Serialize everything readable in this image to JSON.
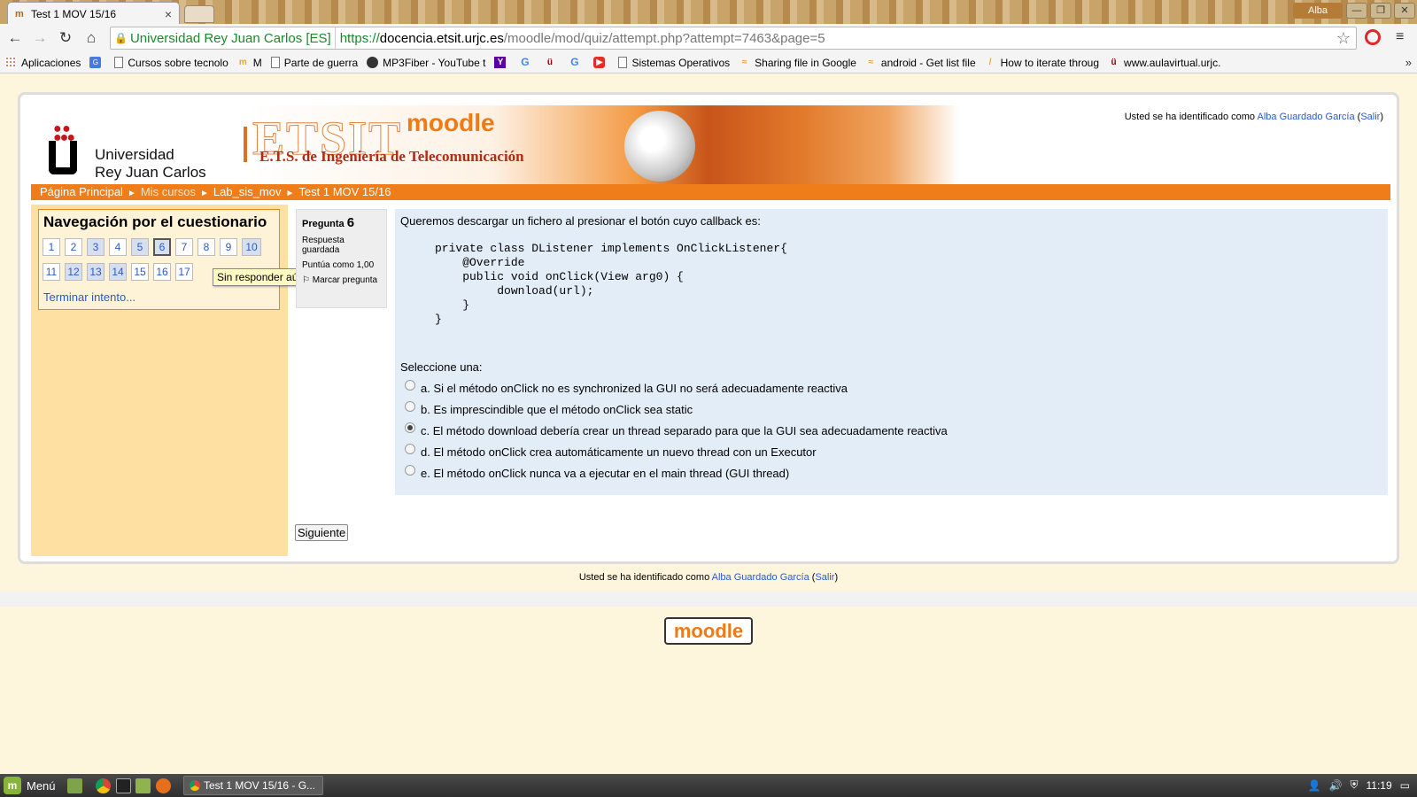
{
  "browser": {
    "tab_title": "Test 1 MOV 15/16",
    "tab_close": "×",
    "profile_name": "Alba",
    "window_buttons": [
      "—",
      "❐",
      "✕"
    ],
    "nav_icons": [
      "←",
      "→",
      "↻",
      "⌂"
    ],
    "ev_badge": "Universidad Rey Juan Carlos [ES]",
    "url_scheme": "https://",
    "url_host": "docencia.etsit.urjc.es",
    "url_path": "/moodle/mod/quiz/attempt.php?attempt=7463&page=5",
    "bookmarks": [
      {
        "icon": "apps-icon",
        "label": "Aplicaciones"
      },
      {
        "icon": "translate-icon",
        "label": ""
      },
      {
        "icon": "page-icon",
        "label": "Cursos sobre tecnolo"
      },
      {
        "icon": "moodle-icon",
        "label": "M"
      },
      {
        "icon": "page-icon",
        "label": "Parte de guerra"
      },
      {
        "icon": "mp3fiber-icon",
        "label": "MP3Fiber - YouTube t"
      },
      {
        "icon": "yahoo-icon",
        "label": ""
      },
      {
        "icon": "google-icon",
        "label": ""
      },
      {
        "icon": "urjc-icon",
        "label": ""
      },
      {
        "icon": "google-icon",
        "label": ""
      },
      {
        "icon": "youtube-icon",
        "label": ""
      },
      {
        "icon": "page-icon",
        "label": "Sistemas Operativos"
      },
      {
        "icon": "drive-icon",
        "label": "Sharing file in Google"
      },
      {
        "icon": "stackoverflow-icon",
        "label": "android - Get list file"
      },
      {
        "icon": "feather-icon",
        "label": "How to iterate throug"
      },
      {
        "icon": "urjc-icon",
        "label": "www.aulavirtual.urjc."
      }
    ],
    "bookmarks_more": "»"
  },
  "header": {
    "university_line1": "Universidad",
    "university_line2": "Rey Juan Carlos",
    "banner_title": "ETSIT",
    "banner_moodle": "moodle",
    "banner_subtitle": "E.T.S. de Ingeniería de Telecomunicación",
    "login_prefix": "Usted se ha identificado como ",
    "login_user": "Alba Guardado García",
    "login_logout": "Salir"
  },
  "breadcrumb": {
    "items": [
      "Página Principal",
      "Mis cursos",
      "Lab_sis_mov",
      "Test 1 MOV 15/16"
    ],
    "separator": "►"
  },
  "quiz_nav": {
    "title": "Navegación por el cuestionario",
    "questions": [
      {
        "n": "1",
        "state": "unanswered"
      },
      {
        "n": "2",
        "state": "unanswered"
      },
      {
        "n": "3",
        "state": "answered"
      },
      {
        "n": "4",
        "state": "unanswered"
      },
      {
        "n": "5",
        "state": "answered"
      },
      {
        "n": "6",
        "state": "current"
      },
      {
        "n": "7",
        "state": "unanswered"
      },
      {
        "n": "8",
        "state": "unanswered"
      },
      {
        "n": "9",
        "state": "unanswered"
      },
      {
        "n": "10",
        "state": "answered"
      },
      {
        "n": "11",
        "state": "unanswered"
      },
      {
        "n": "12",
        "state": "answered"
      },
      {
        "n": "13",
        "state": "answered"
      },
      {
        "n": "14",
        "state": "answered"
      },
      {
        "n": "15",
        "state": "unanswered"
      },
      {
        "n": "16",
        "state": "unanswered"
      },
      {
        "n": "17",
        "state": "unanswered"
      }
    ],
    "finish_link": "Terminar intento...",
    "tooltip": "Sin responder aún"
  },
  "question": {
    "label": "Pregunta",
    "number": "6",
    "status": "Respuesta guardada",
    "score": "Puntúa como 1,00",
    "flag_label": "Marcar pregunta",
    "text": "Queremos descargar un fichero al presionar el botón cuyo callback es:",
    "code": "private class DListener implements OnClickListener{\n    @Override\n    public void onClick(View arg0) {\n         download(url);\n    }\n}",
    "prompt": "Seleccione una:",
    "options": [
      {
        "text": "a. Si el método onClick no es synchronized la GUI no será adecuadamente reactiva",
        "checked": false
      },
      {
        "text": "b. Es imprescindible que el método onClick sea static",
        "checked": false
      },
      {
        "text": "c. El método download debería crear un thread separado para que la GUI sea adecuadamente reactiva",
        "checked": true
      },
      {
        "text": "d. El método onClick crea automáticamente un nuevo thread con un Executor",
        "checked": false
      },
      {
        "text": "e. El método onClick nunca va a ejecutar en el main thread (GUI thread)",
        "checked": false
      }
    ],
    "next_button": "Siguiente"
  },
  "footer": {
    "login_prefix": "Usted se ha identificado como ",
    "login_user": "Alba Guardado García",
    "login_logout": "Salir",
    "moodle_logo": "moodle"
  },
  "taskbar": {
    "start_label": "Menú",
    "task_title": "Test 1 MOV 15/16 - G...",
    "clock": "11:19"
  },
  "colors": {
    "accent_orange": "#ef7d1a",
    "link_blue": "#2b5ac8",
    "question_bg": "#e3edf7",
    "sidebar_bg": "#fde0a2"
  }
}
